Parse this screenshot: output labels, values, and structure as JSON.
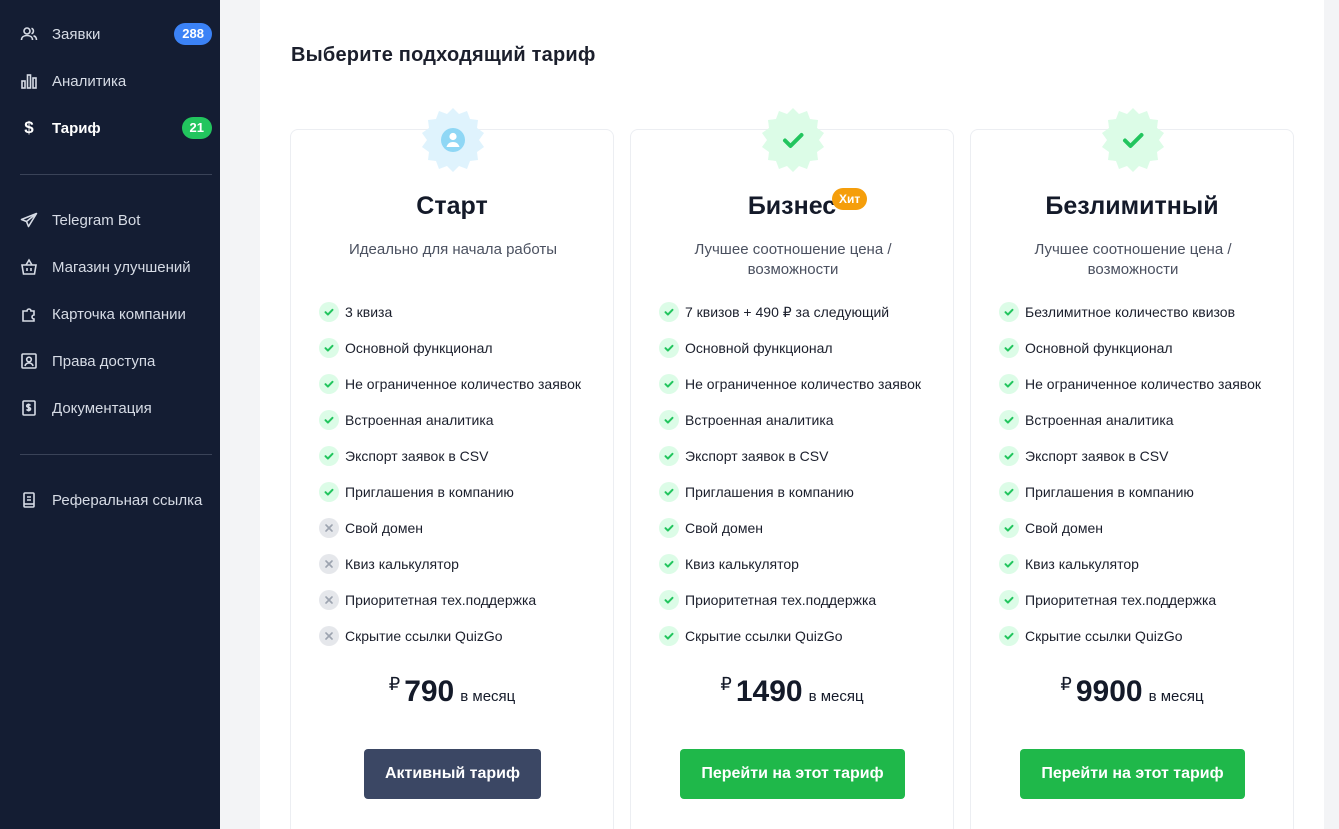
{
  "sidebar": {
    "items": [
      {
        "label": "Заявки",
        "icon": "users-icon",
        "badge": "288",
        "badge_color": "#3b82f6"
      },
      {
        "label": "Аналитика",
        "icon": "bar-chart-icon"
      },
      {
        "label": "Тариф",
        "icon": "dollar-icon",
        "badge": "21",
        "badge_color": "#22c55e",
        "active": true
      },
      {
        "label": "Telegram Bot",
        "icon": "telegram-icon"
      },
      {
        "label": "Магазин улучшений",
        "icon": "basket-icon"
      },
      {
        "label": "Карточка компании",
        "icon": "puzzle-icon"
      },
      {
        "label": "Права доступа",
        "icon": "user-square-icon"
      },
      {
        "label": "Документация",
        "icon": "document-dollar-icon"
      },
      {
        "label": "Реферальная ссылка",
        "icon": "book-icon"
      }
    ]
  },
  "page": {
    "title": "Выберите подходящий тариф"
  },
  "plans": [
    {
      "name": "Старт",
      "description": "Идеально для начала работы",
      "icon": "user-seal-icon",
      "features": [
        {
          "text": "3 квиза",
          "included": true
        },
        {
          "text": "Основной функционал",
          "included": true
        },
        {
          "text": "Не ограниченное количество заявок",
          "included": true
        },
        {
          "text": "Встроенная аналитика",
          "included": true
        },
        {
          "text": "Экспорт заявок в CSV",
          "included": true
        },
        {
          "text": "Приглашения в компанию",
          "included": true
        },
        {
          "text": "Свой домен",
          "included": false
        },
        {
          "text": "Квиз калькулятор",
          "included": false
        },
        {
          "text": "Приоритетная тех.поддержка",
          "included": false
        },
        {
          "text": "Скрытие ссылки QuizGo",
          "included": false
        }
      ],
      "currency": "₽",
      "price": "790",
      "period": "в месяц",
      "button": "Активный тариф"
    },
    {
      "name": "Бизнес",
      "badge": "Хит",
      "description": "Лучшее соотношение цена / возможности",
      "icon": "check-seal-icon",
      "features": [
        {
          "text": "7 квизов + 490 ₽ за следующий",
          "included": true
        },
        {
          "text": "Основной функционал",
          "included": true
        },
        {
          "text": "Не ограниченное количество заявок",
          "included": true
        },
        {
          "text": "Встроенная аналитика",
          "included": true
        },
        {
          "text": "Экспорт заявок в CSV",
          "included": true
        },
        {
          "text": "Приглашения в компанию",
          "included": true
        },
        {
          "text": "Свой домен",
          "included": true
        },
        {
          "text": "Квиз калькулятор",
          "included": true
        },
        {
          "text": "Приоритетная тех.поддержка",
          "included": true
        },
        {
          "text": "Скрытие ссылки QuizGo",
          "included": true
        }
      ],
      "currency": "₽",
      "price": "1490",
      "period": "в месяц",
      "button": "Перейти на этот тариф"
    },
    {
      "name": "Безлимитный",
      "description": "Лучшее соотношение цена / возможности",
      "icon": "check-seal-icon",
      "features": [
        {
          "text": "Безлимитное количество квизов",
          "included": true
        },
        {
          "text": "Основной функционал",
          "included": true
        },
        {
          "text": "Не ограниченное количество заявок",
          "included": true
        },
        {
          "text": "Встроенная аналитика",
          "included": true
        },
        {
          "text": "Экспорт заявок в CSV",
          "included": true
        },
        {
          "text": "Приглашения в компанию",
          "included": true
        },
        {
          "text": "Свой домен",
          "included": true
        },
        {
          "text": "Квиз калькулятор",
          "included": true
        },
        {
          "text": "Приоритетная тех.поддержка",
          "included": true
        },
        {
          "text": "Скрытие ссылки QuizGo",
          "included": true
        }
      ],
      "currency": "₽",
      "price": "9900",
      "period": "в месяц",
      "button": "Перейти на этот тариф"
    }
  ],
  "colors": {
    "sidebar_bg": "#141d33",
    "accent_green": "#1fb84a",
    "active_button": "#3b4764",
    "hit_badge": "#f59e0b"
  }
}
